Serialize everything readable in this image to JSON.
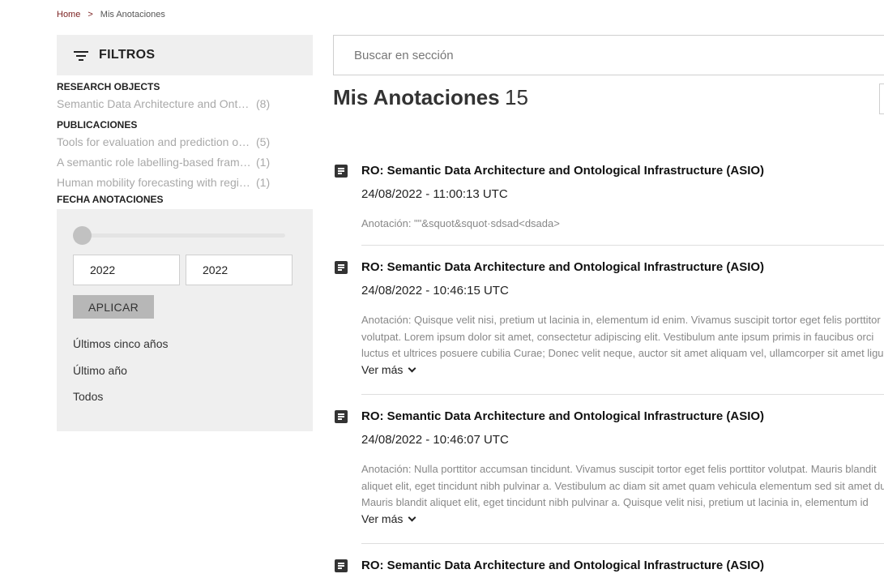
{
  "breadcrumb": {
    "home": "Home",
    "separator": ">",
    "current": "Mis Anotaciones"
  },
  "filters": {
    "title": "FILTROS",
    "research_objects": {
      "title": "RESEARCH OBJECTS",
      "items": [
        {
          "label": "Semantic Data Architecture and Ontological Infrastructure (ASIO)",
          "count": "(8)"
        }
      ]
    },
    "publicaciones": {
      "title": "PUBLICACIONES",
      "items": [
        {
          "label": "Tools for evaluation and prediction of …",
          "count": "(5)"
        },
        {
          "label": "A semantic role labelling-based framework …",
          "count": "(1)"
        },
        {
          "label": "Human mobility forecasting with region …",
          "count": "(1)"
        }
      ]
    },
    "fecha": {
      "title": "FECHA ANOTACIONES",
      "slider_level": 0,
      "from_year": "2022",
      "to_year": "2022",
      "apply_label": "APLICAR",
      "quick_links": [
        "Últimos cinco años",
        "Último año",
        "Todos"
      ]
    }
  },
  "search": {
    "placeholder": "Buscar en sección",
    "value": ""
  },
  "main": {
    "title": "Mis Anotaciones",
    "count": "15"
  },
  "results": [
    {
      "title": "RO: Semantic Data Architecture and Ontological Infrastructure (ASIO)",
      "date": "24/08/2022 - 11:00:13 UTC",
      "annotation": "Anotación: \"\"&squot&squot·sdsad<dsada>",
      "see_more": ""
    },
    {
      "title": "RO: Semantic Data Architecture and Ontological Infrastructure (ASIO)",
      "date": "24/08/2022 - 10:46:15 UTC",
      "annotation": "Anotación: Quisque velit nisi, pretium ut lacinia in, elementum id enim. Vivamus suscipit tortor eget felis porttitor volutpat. Lorem ipsum dolor sit amet, consectetur adipiscing elit. Vestibulum ante ipsum primis in faucibus orci luctus et ultrices posuere cubilia Curae; Donec velit neque, auctor sit amet aliquam vel, ullamcorper sit amet ligula. Curabitur aliquet quam id dui posuere blandit. Curabitur aliquet quam id dui posuere blandit.",
      "see_more": "Ver más"
    },
    {
      "title": "RO: Semantic Data Architecture and Ontological Infrastructure (ASIO)",
      "date": "24/08/2022 - 10:46:07 UTC",
      "annotation": "Anotación: Nulla porttitor accumsan tincidunt. Vivamus suscipit tortor eget felis porttitor volutpat. Mauris blandit aliquet elit, eget tincidunt nibh pulvinar a. Vestibulum ac diam sit amet quam vehicula elementum sed sit amet dui. Mauris blandit aliquet elit, eget tincidunt nibh pulvinar a. Quisque velit nisi, pretium ut lacinia in, elementum id enim. Donec rutrum congue leo eget malesuada. Sed porttitor lectus nibh.",
      "see_more": "Ver más"
    },
    {
      "title": "RO: Semantic Data Architecture and Ontological Infrastructure (ASIO)"
    }
  ],
  "colors": {
    "accent": "#7a1f1f",
    "panel_bg": "#efefef",
    "muted_text": "#a9a9a9"
  },
  "icons": {
    "filter": "filter-lines-icon",
    "result": "document-icon",
    "expand": "chevron-down-icon"
  }
}
